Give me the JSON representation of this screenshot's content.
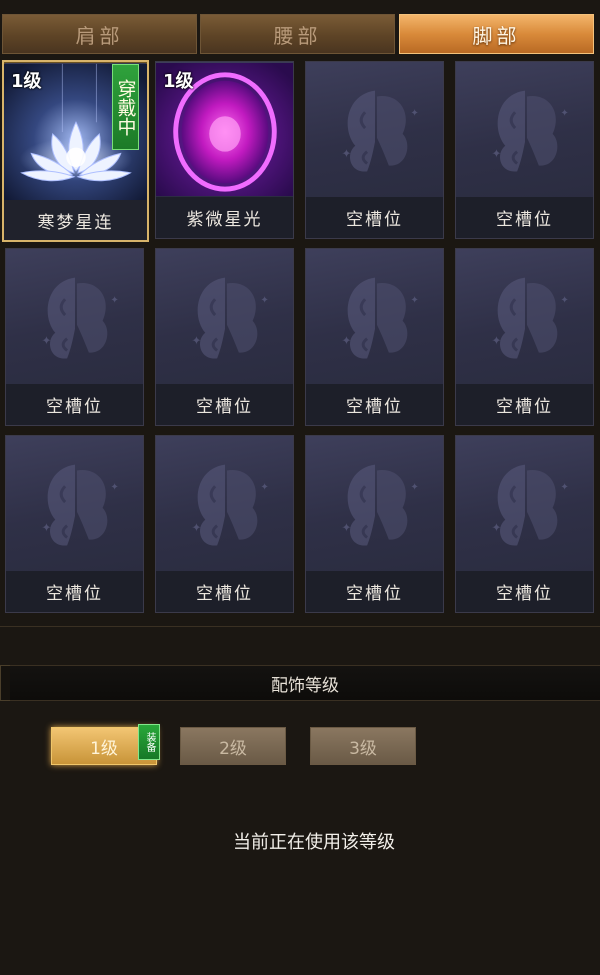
{
  "tabs": [
    {
      "label": "肩部",
      "active": false
    },
    {
      "label": "腰部",
      "active": false
    },
    {
      "label": "脚部",
      "active": true
    }
  ],
  "slots": [
    {
      "name": "寒梦星连",
      "level": "1级",
      "wearing": "穿戴中",
      "type": "lotus"
    },
    {
      "name": "紫微星光",
      "level": "1级",
      "type": "orb"
    },
    {
      "name": "空槽位",
      "type": "empty"
    },
    {
      "name": "空槽位",
      "type": "empty"
    },
    {
      "name": "空槽位",
      "type": "empty"
    },
    {
      "name": "空槽位",
      "type": "empty"
    },
    {
      "name": "空槽位",
      "type": "empty"
    },
    {
      "name": "空槽位",
      "type": "empty"
    },
    {
      "name": "空槽位",
      "type": "empty"
    },
    {
      "name": "空槽位",
      "type": "empty"
    },
    {
      "name": "空槽位",
      "type": "empty"
    },
    {
      "name": "空槽位",
      "type": "empty"
    }
  ],
  "level_section": {
    "title": "配饰等级",
    "buttons": [
      "1级",
      "2级",
      "3级"
    ],
    "active_index": 0,
    "equip_badge": "装备",
    "status": "当前正在使用该等级"
  },
  "colors": {
    "tab_active": "#d98a3a",
    "slot_selected_border": "#d8b46a",
    "wearing_badge": "#2fa23c",
    "orb": "#e01cc8"
  }
}
